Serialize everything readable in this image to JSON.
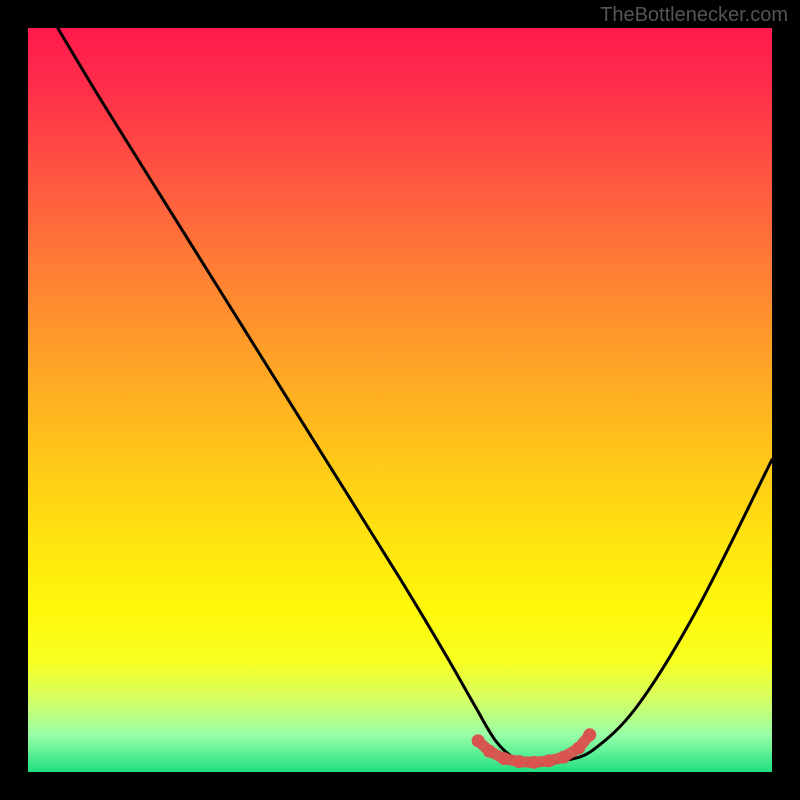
{
  "watermark": "TheBottlenecker.com",
  "chart_data": {
    "type": "line",
    "title": "",
    "xlabel": "",
    "ylabel": "",
    "xlim": [
      0,
      100
    ],
    "ylim": [
      0,
      100
    ],
    "series": [
      {
        "name": "bottleneck-curve",
        "x": [
          4,
          10,
          20,
          30,
          40,
          50,
          56,
          60,
          63,
          66,
          69,
          72,
          76,
          82,
          90,
          100
        ],
        "y": [
          100,
          90,
          74,
          58,
          42,
          26,
          16,
          9,
          4,
          1.5,
          1,
          1.5,
          3,
          9,
          22,
          42
        ],
        "color": "#000000"
      },
      {
        "name": "highlight-dots",
        "type": "scatter",
        "x": [
          60.5,
          62,
          64,
          66,
          68,
          70,
          72,
          74,
          75.5
        ],
        "y": [
          4.2,
          2.8,
          1.8,
          1.4,
          1.3,
          1.5,
          2.0,
          3.2,
          5.0
        ],
        "color": "#d9534f"
      }
    ],
    "gradient_stops": [
      {
        "pos": 0.0,
        "color": "#ff1a4d"
      },
      {
        "pos": 0.5,
        "color": "#ffc21a"
      },
      {
        "pos": 0.85,
        "color": "#f8ff20"
      },
      {
        "pos": 1.0,
        "color": "#20e080"
      }
    ]
  }
}
